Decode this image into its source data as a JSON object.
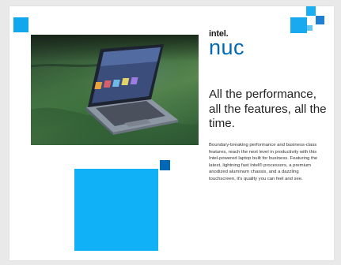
{
  "brand": {
    "intel": "intel.",
    "nuc": "nuc"
  },
  "headline": "All the performance, all the features, all the time.",
  "body": "Boundary-breaking performance and business-class features, reach the next level in productivity with this Intel-powered laptop built for business. Featuring the latest, lightning fast Intel® processors, a premium anodized aluminum chassis, and a dazzling touchscreen, it's quality you can feel and see.",
  "colors": {
    "intel_blue": "#0068b5",
    "bright_blue": "#11b1f8",
    "sofa_green": "#3f6d3f"
  },
  "icons": [
    "laptop-photo"
  ]
}
